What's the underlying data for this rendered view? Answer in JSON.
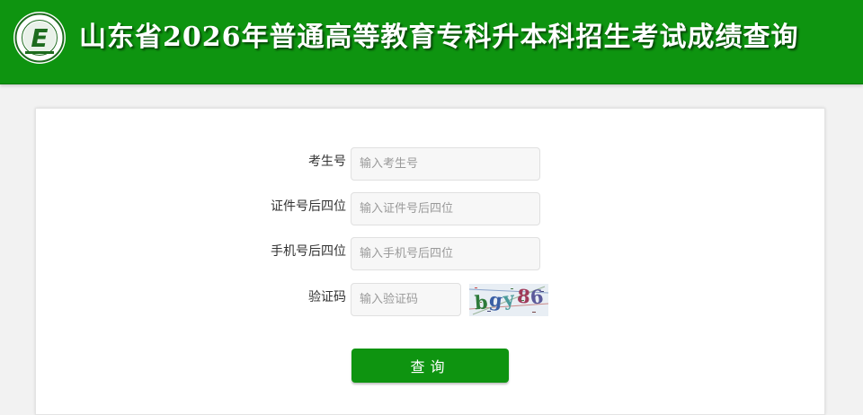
{
  "header": {
    "title": "山东省2026年普通高等教育专科升本科招生考试成绩查询",
    "logo_letter": "E",
    "background_color": "#0e9410"
  },
  "form": {
    "fields": [
      {
        "label": "考生号",
        "placeholder": "输入考生号",
        "value": ""
      },
      {
        "label": "证件号后四位",
        "placeholder": "输入证件号后四位",
        "value": ""
      },
      {
        "label": "手机号后四位",
        "placeholder": "输入手机号后四位",
        "value": ""
      },
      {
        "label": "验证码",
        "placeholder": "输入验证码",
        "value": ""
      }
    ],
    "captcha_text": "bgy86",
    "submit_label": "查询",
    "accent_color": "#0e9410"
  }
}
